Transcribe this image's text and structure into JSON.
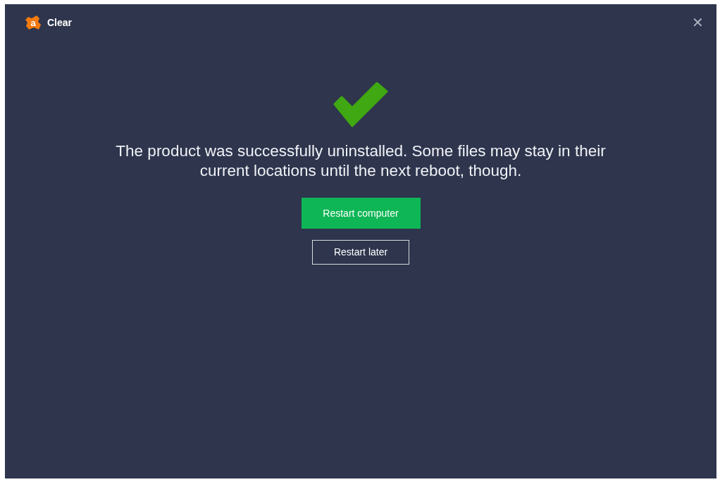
{
  "window": {
    "logo_letter": "a",
    "title": "Clear",
    "close": "✕"
  },
  "message": "The product was successfully uninstalled. Some files may stay in their current locations until the next reboot, though.",
  "buttons": [
    {
      "kind": "primary",
      "label": "Restart computer"
    },
    {
      "kind": "secondary",
      "label": "Restart later"
    }
  ]
}
